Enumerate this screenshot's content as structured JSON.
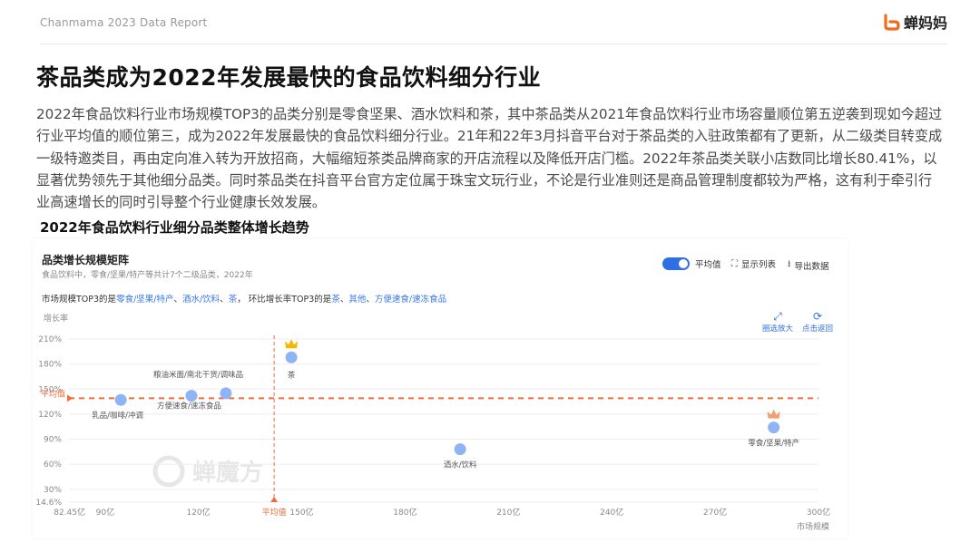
{
  "header": {
    "report": "Chanmama 2023 Data Report",
    "brand": "蝉妈妈"
  },
  "title": "茶品类成为2022年发展最快的食品饮料细分行业",
  "paragraph": "2022年食品饮料行业市场规模TOP3的品类分别是零食坚果、酒水饮料和茶，其中茶品类从2021年食品饮料行业市场容量顺位第五逆袭到现如今超过行业平均值的顺位第三，成为2022年发展最快的食品饮料细分行业。21年和22年3月抖音平台对于茶品类的入驻政策都有了更新，从二级类目转变成一级特邀类目，再由定向准入转为开放招商，大幅缩短茶类品牌商家的开店流程以及降低开店门槛。2022年茶品类关联小店数同比增长80.41%，以显著优势领先于其他细分品类。同时茶品类在抖音平台官方定位属于珠宝文玩行业，不论是行业准则还是商品管理制度都较为严格，这有利于牵引行业高速增长的同时引导整个行业健康长效发展。",
  "chart_title": "2022年食品饮料行业细分品类整体增长趋势",
  "panel": {
    "title": "品类增长规模矩阵",
    "subtitle": "食品饮料中，零食/坚果/特产等共计7个二级品类，2022年",
    "top3_prefix": "市场规模TOP3的是",
    "top3_size": [
      "零食/坚果/特产",
      "酒水/饮料",
      "茶"
    ],
    "top3_mid": "环比增长率TOP3的是",
    "top3_growth": [
      "茶",
      "其他",
      "方便速食/速冻食品"
    ],
    "toggle_label": "平均值",
    "show_list": "显示列表",
    "export": "导出数据",
    "zoom_label": "圈选放大",
    "reset_label": "点击返回",
    "watermark": "蝉魔方",
    "colors": {
      "accent": "#2f6fe4",
      "point": "#8fb4f5",
      "average": "#f26b3a",
      "crown": "#f5b800"
    }
  },
  "chart_data": {
    "type": "scatter",
    "xlabel": "市场规模",
    "ylabel": "增长率",
    "xlim": [
      82.45,
      300
    ],
    "ylim": [
      14.6,
      210
    ],
    "x_ticks": [
      "82.45亿",
      "90亿",
      "120亿",
      "150亿",
      "180亿",
      "210亿",
      "240亿",
      "270亿",
      "300亿"
    ],
    "x_tick_values": [
      82.45,
      90,
      120,
      150,
      180,
      210,
      240,
      270,
      300
    ],
    "y_ticks": [
      "14.6%",
      "30%",
      "60%",
      "90%",
      "120%",
      "150%",
      "180%",
      "210%"
    ],
    "y_tick_values": [
      14.6,
      30,
      60,
      90,
      120,
      150,
      180,
      210
    ],
    "avg_x_label": "平均值",
    "avg_y_label": "平均值",
    "avg_x": 142,
    "avg_y": 139,
    "points": [
      {
        "label": "茶",
        "x": 147,
        "y": 188,
        "crown": true
      },
      {
        "label": "粮油米面/南北干货/调味品",
        "x": 128,
        "y": 145
      },
      {
        "label": "方便速食/速冻食品",
        "x": 118,
        "y": 142
      },
      {
        "label": "乳品/咖啡/冲调",
        "x": 97.5,
        "y": 137
      },
      {
        "label": "酒水/饮料",
        "x": 196,
        "y": 78
      },
      {
        "label": "零食/坚果/特产",
        "x": 287,
        "y": 104,
        "crown": true
      }
    ]
  }
}
